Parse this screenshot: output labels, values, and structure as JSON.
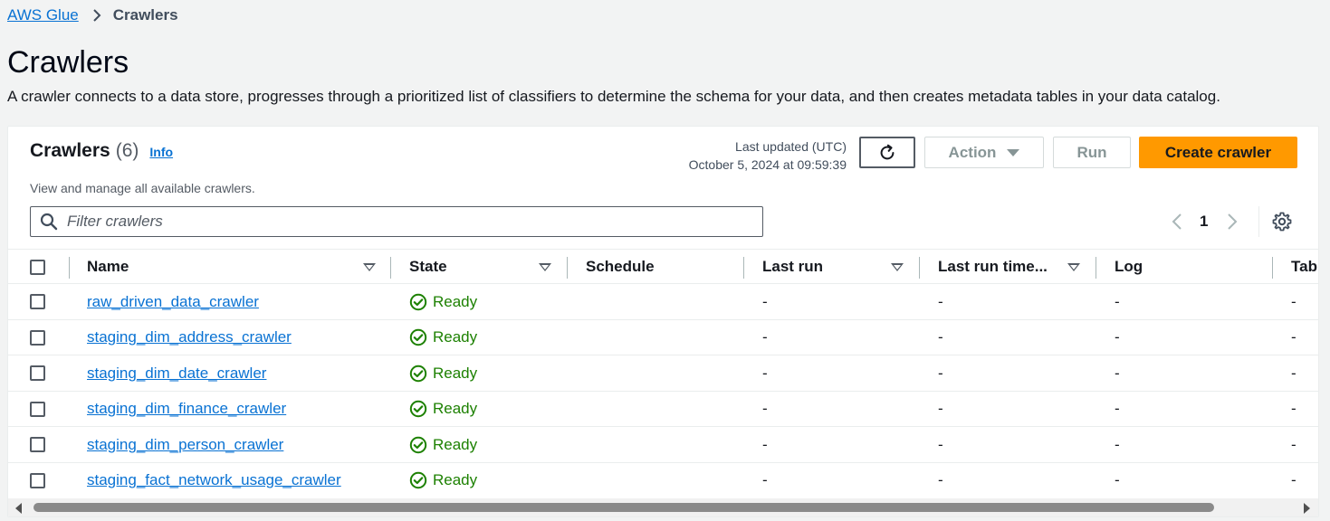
{
  "breadcrumb": {
    "root": "AWS Glue",
    "current": "Crawlers"
  },
  "page": {
    "title": "Crawlers",
    "description": "A crawler connects to a data store, progresses through a prioritized list of classifiers to determine the schema for your data, and then creates metadata tables in your data catalog."
  },
  "panel": {
    "title": "Crawlers",
    "count": "(6)",
    "info": "Info",
    "subtitle": "View and manage all available crawlers.",
    "last_updated_label": "Last updated (UTC)",
    "last_updated_value": "October 5, 2024 at 09:59:39",
    "action_label": "Action",
    "run_label": "Run",
    "create_label": "Create crawler",
    "filter_placeholder": "Filter crawlers",
    "page_number": "1"
  },
  "table": {
    "columns": [
      "Name",
      "State",
      "Schedule",
      "Last run",
      "Last run time...",
      "Log",
      "Tabl"
    ],
    "rows": [
      {
        "name": "raw_driven_data_crawler",
        "state": "Ready",
        "schedule": "",
        "last_run": "-",
        "last_run_time": "-",
        "log": "-",
        "table": "-"
      },
      {
        "name": "staging_dim_address_crawler",
        "state": "Ready",
        "schedule": "",
        "last_run": "-",
        "last_run_time": "-",
        "log": "-",
        "table": "-"
      },
      {
        "name": "staging_dim_date_crawler",
        "state": "Ready",
        "schedule": "",
        "last_run": "-",
        "last_run_time": "-",
        "log": "-",
        "table": "-"
      },
      {
        "name": "staging_dim_finance_crawler",
        "state": "Ready",
        "schedule": "",
        "last_run": "-",
        "last_run_time": "-",
        "log": "-",
        "table": "-"
      },
      {
        "name": "staging_dim_person_crawler",
        "state": "Ready",
        "schedule": "",
        "last_run": "-",
        "last_run_time": "-",
        "log": "-",
        "table": "-"
      },
      {
        "name": "staging_fact_network_usage_crawler",
        "state": "Ready",
        "schedule": "",
        "last_run": "-",
        "last_run_time": "-",
        "log": "-",
        "table": "-"
      }
    ]
  },
  "colors": {
    "link": "#0972d3",
    "success": "#1d8102",
    "primary": "#ff9900"
  },
  "icons": {
    "breadcrumb_separator": "chevron-right-icon",
    "refresh": "refresh-icon",
    "action_caret": "caret-down-icon",
    "search": "search-icon",
    "pager_prev": "chevron-left-icon",
    "pager_next": "chevron-right-icon",
    "settings": "gear-icon",
    "status": "check-circle-icon",
    "sort": "sort-down-icon"
  }
}
